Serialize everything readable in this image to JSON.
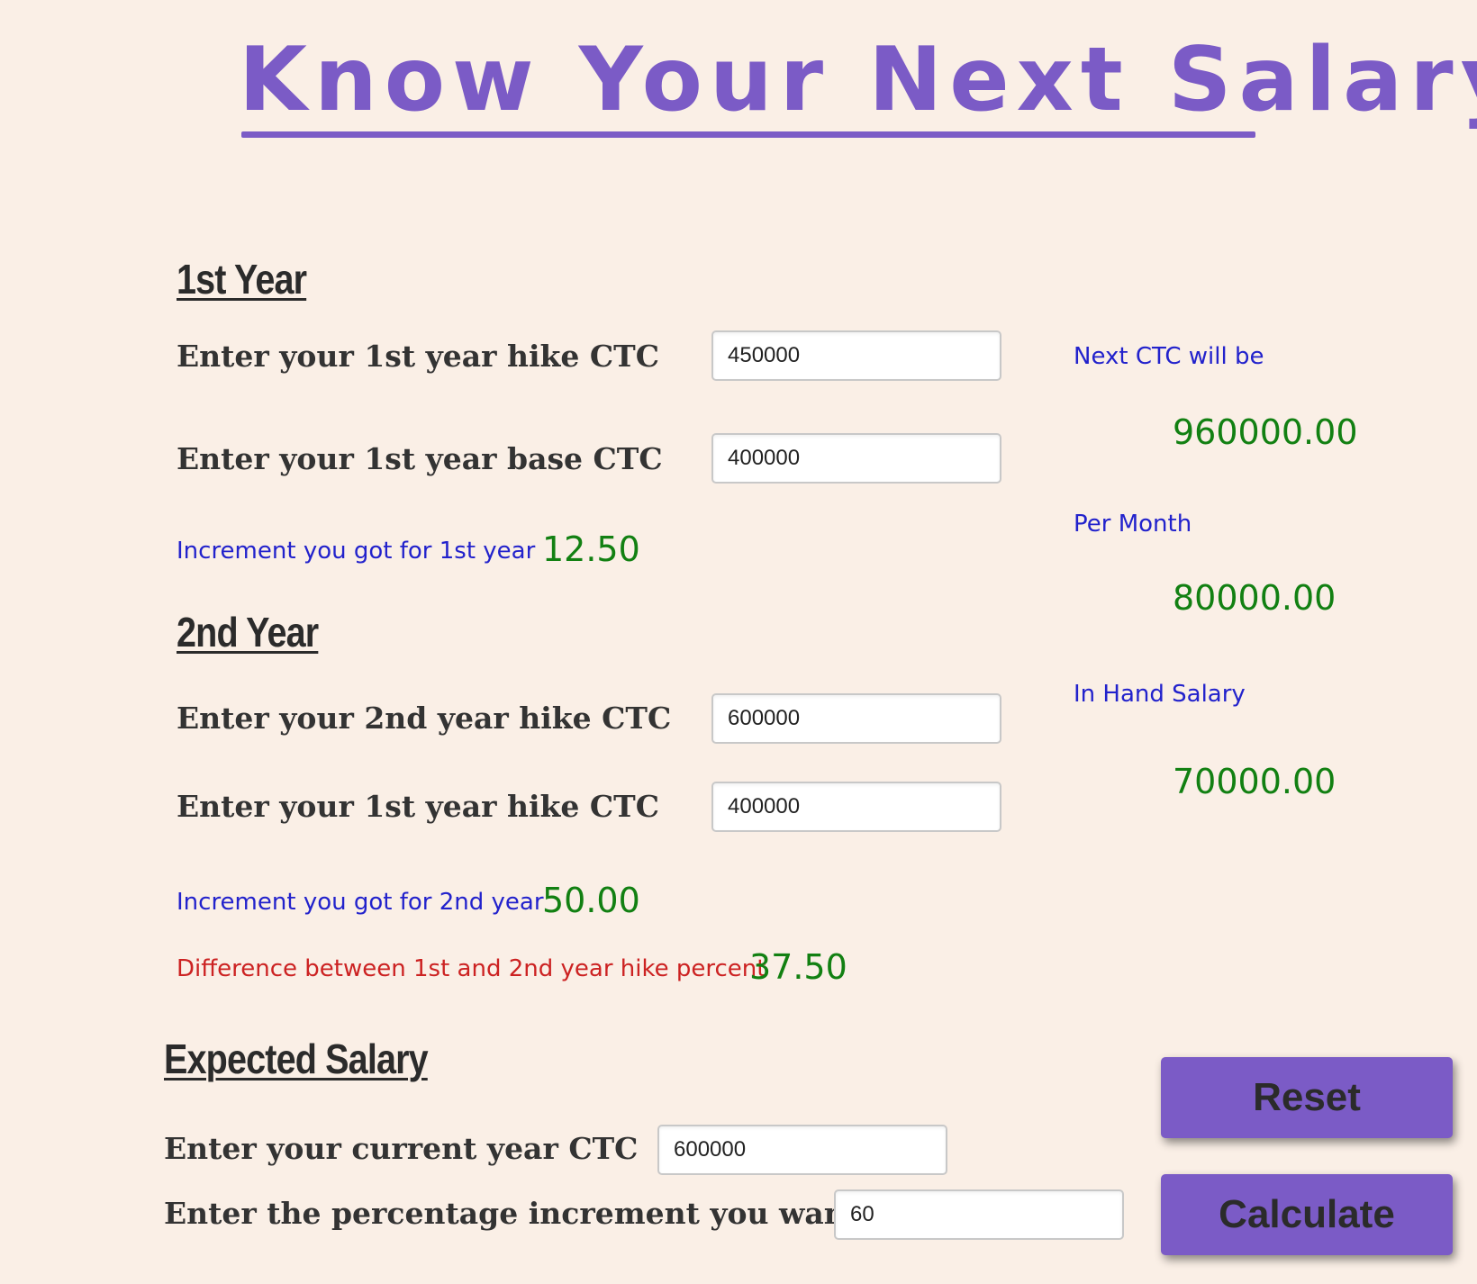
{
  "header": {
    "title": "Know Your Next Salary"
  },
  "first_year": {
    "heading": "1st Year",
    "hike_ctc_label": "Enter your 1st year hike CTC",
    "hike_ctc_value": "450000",
    "base_ctc_label": "Enter your 1st year base CTC",
    "base_ctc_value": "400000",
    "increment_label": "Increment you got for 1st year",
    "increment_value": "12.50"
  },
  "second_year": {
    "heading": "2nd Year",
    "hike_ctc_label": "Enter your 2nd year hike CTC",
    "hike_ctc_value": "600000",
    "prev_ctc_label": "Enter your 1st year hike CTC",
    "prev_ctc_value": "400000",
    "increment_label": "Increment you got for 2nd year",
    "increment_value": "50.00",
    "difference_label": "Difference between 1st and 2nd year hike percent",
    "difference_value": "37.50"
  },
  "results": {
    "next_ctc_label": "Next CTC will be",
    "next_ctc_value": "960000.00",
    "per_month_label": "Per Month",
    "per_month_value": "80000.00",
    "in_hand_label": "In Hand Salary",
    "in_hand_value": "70000.00"
  },
  "expected_salary": {
    "heading": "Expected Salary",
    "current_ctc_label": "Enter your current year CTC",
    "current_ctc_value": "600000",
    "percent_label": "Enter the percentage increment you want",
    "percent_value": "60"
  },
  "buttons": {
    "reset_label": "Reset",
    "calculate_label": "Calculate"
  },
  "colors": {
    "accent": "#7b5bc6",
    "background": "#faefe6",
    "info_text": "#2222cc",
    "result_text": "#128012",
    "difference_text": "#cc2222"
  }
}
